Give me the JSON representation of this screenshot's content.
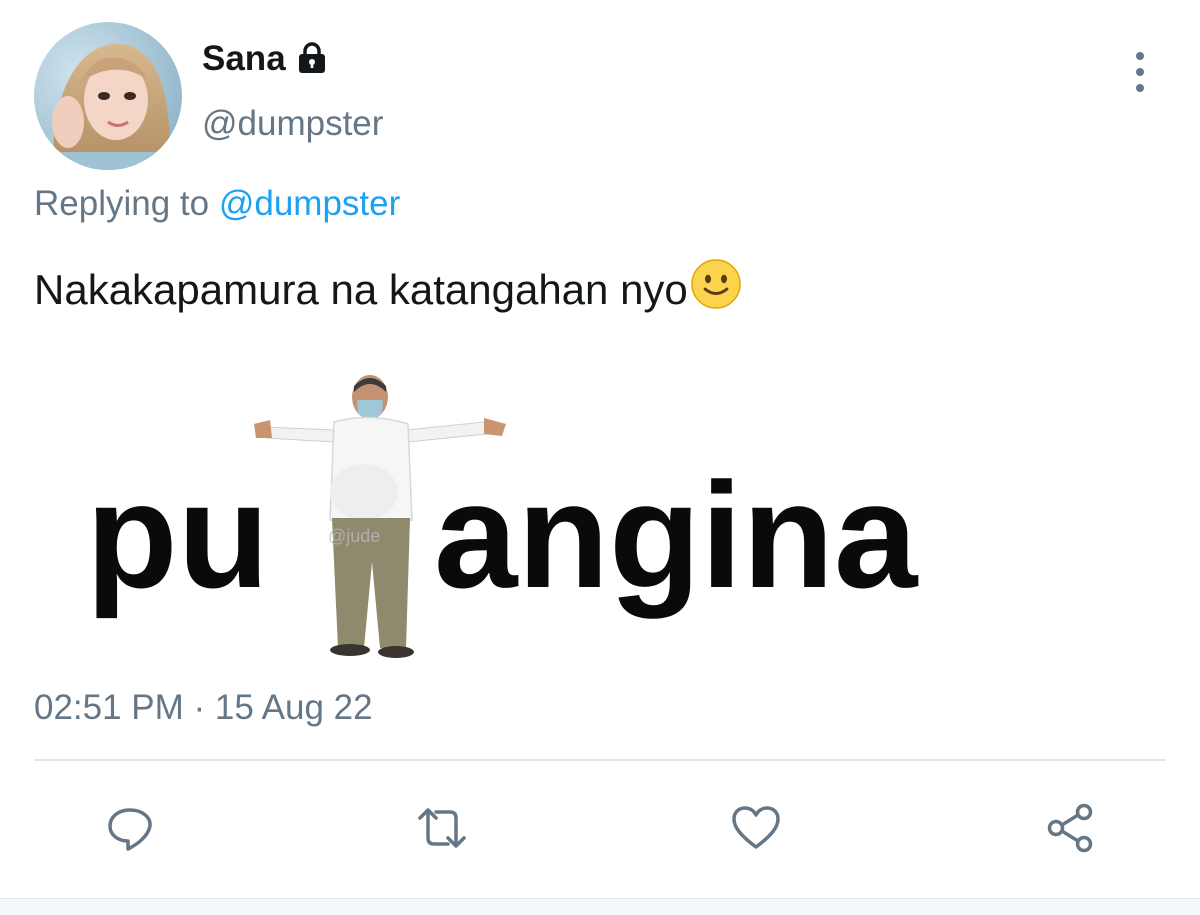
{
  "author": {
    "display_name": "Sana",
    "handle": "@dumpster",
    "avatar_icon": "profile-photo",
    "protected_icon": "lock-icon"
  },
  "reply": {
    "prefix": "Replying to",
    "target": "@dumpster"
  },
  "tweet": {
    "text": "Nakakapamura na katangahan nyo",
    "emoji": "slightly-smiling-face",
    "timestamp": "02:51 PM · 15 Aug 22"
  },
  "media": {
    "left_text": "pu",
    "right_text": "angina",
    "watermark": "@jude"
  },
  "actions": {
    "reply_icon": "reply-icon",
    "retweet_icon": "retweet-icon",
    "like_icon": "heart-icon",
    "share_icon": "share-icon"
  },
  "colors": {
    "primary_text": "#14171a",
    "secondary_text": "#657786",
    "link": "#1da1f2",
    "divider": "#e1e8ed"
  }
}
